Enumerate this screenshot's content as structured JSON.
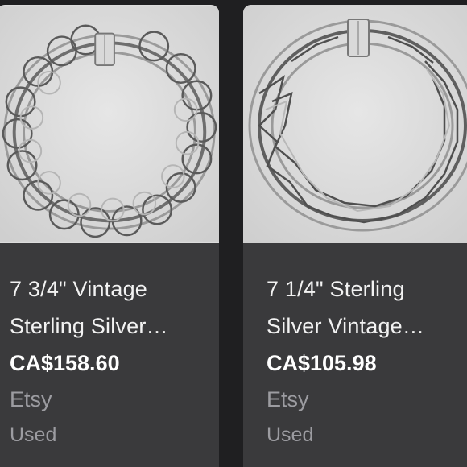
{
  "listings": [
    {
      "image_icon": "bracelet-photo",
      "title_line1": "7 3/4\" Vintage",
      "title_line2": "Sterling Silver…",
      "price": "CA$158.60",
      "seller": "Etsy",
      "condition": "Used"
    },
    {
      "image_icon": "bracelet-photo",
      "title_line1": "7 1/4\" Sterling",
      "title_line2": "Silver Vintage…",
      "price": "CA$105.98",
      "seller": "Etsy",
      "condition": "Used"
    }
  ],
  "colors": {
    "background": "#1f1f21",
    "card": "#3a3a3c",
    "photo_background": "#dcdcdc",
    "title": "#f2f2f2",
    "muted": "#9c9ca1"
  }
}
